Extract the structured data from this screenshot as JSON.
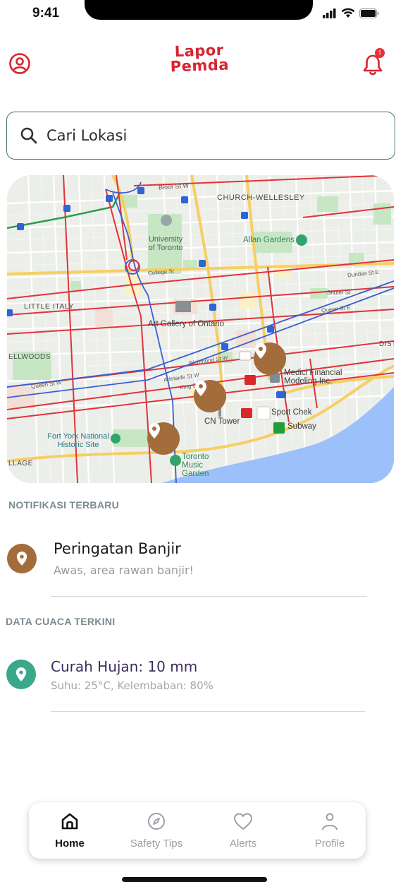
{
  "status_bar": {
    "time": "9:41",
    "icons": [
      "signal-icon",
      "wifi-icon",
      "battery-icon"
    ]
  },
  "header": {
    "logo_line1": "Lapor",
    "logo_line2": "Pemda",
    "left_icon": "user-circle-icon",
    "right_icon": "bell-icon",
    "notification_count": "1",
    "brand_color": "#d6242f"
  },
  "search": {
    "placeholder": "Cari Lokasi",
    "icon": "search-icon"
  },
  "map": {
    "labels": {
      "church_wellesley": "CHURCH-WELLESLEY",
      "bloor": "Bloor St W",
      "university": "University of Toronto",
      "allan_gardens": "Allan Gardens",
      "college": "College St",
      "little_italy": "LITTLE ITALY",
      "art_gallery": "Art Gallery of Ontario",
      "dundas": "Dundas St E",
      "shuter": "Shuter St",
      "queen": "Queen St E",
      "dist": "DIST",
      "ellwoods": "ELLWOODS",
      "richmond": "Richmond St W",
      "adelaide": "Adelaide St W",
      "king": "King St W",
      "queen_w": "Queen St W",
      "medici": "Medici Financial Modeling Inc.",
      "sport_chek": "Sport Chek",
      "subway": "Subway",
      "cn_tower": "CN Tower",
      "fort_york": "Fort York National Historic Site",
      "village": "LLAGE",
      "music_garden": "Toronto Music Garden"
    },
    "pin_color": "#a36c3b",
    "water_color": "#9cc0f9"
  },
  "notifications": {
    "section_title": "NOTIFIKASI TERBARU",
    "items": [
      {
        "title": "Peringatan Banjir",
        "subtitle": "Awas, area rawan banjir!",
        "icon": "map-pin-icon",
        "color": "#a36c3b"
      }
    ]
  },
  "weather": {
    "section_title": "DATA CUACA TERKINI",
    "items": [
      {
        "title": "Curah Hujan: 10 mm",
        "subtitle": "Suhu: 25°C, Kelembaban: 80%",
        "icon": "map-pin-icon",
        "color": "#3aa88a"
      }
    ]
  },
  "bottom_nav": {
    "items": [
      {
        "label": "Home",
        "icon": "home-icon",
        "active": true
      },
      {
        "label": "Safety Tips",
        "icon": "compass-icon",
        "active": false
      },
      {
        "label": "Alerts",
        "icon": "heart-icon",
        "active": false
      },
      {
        "label": "Profile",
        "icon": "user-icon",
        "active": false
      }
    ]
  }
}
